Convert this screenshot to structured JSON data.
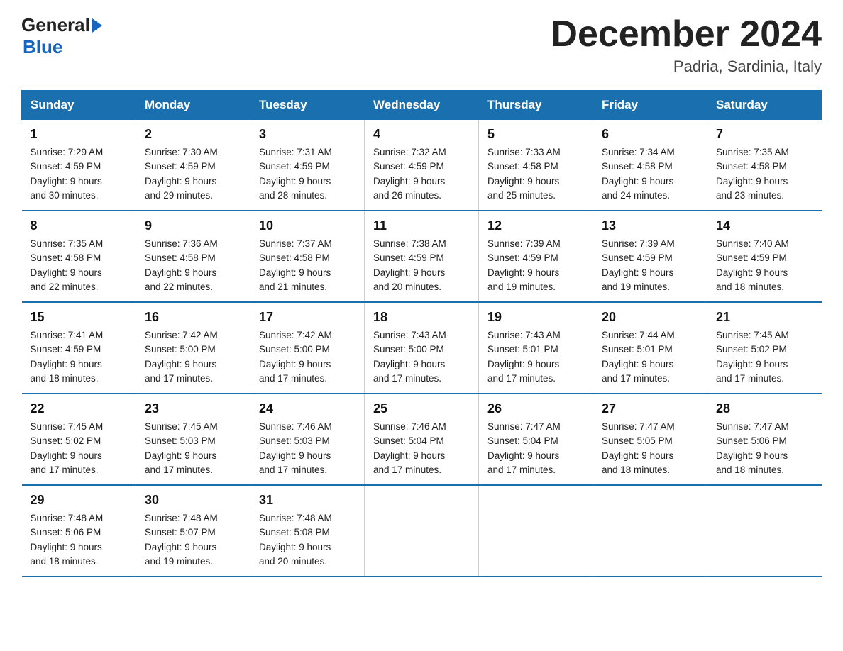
{
  "logo": {
    "general": "General",
    "blue": "Blue"
  },
  "title": "December 2024",
  "location": "Padria, Sardinia, Italy",
  "weekdays": [
    "Sunday",
    "Monday",
    "Tuesday",
    "Wednesday",
    "Thursday",
    "Friday",
    "Saturday"
  ],
  "weeks": [
    [
      {
        "day": "1",
        "sunrise": "7:29 AM",
        "sunset": "4:59 PM",
        "daylight": "9 hours and 30 minutes."
      },
      {
        "day": "2",
        "sunrise": "7:30 AM",
        "sunset": "4:59 PM",
        "daylight": "9 hours and 29 minutes."
      },
      {
        "day": "3",
        "sunrise": "7:31 AM",
        "sunset": "4:59 PM",
        "daylight": "9 hours and 28 minutes."
      },
      {
        "day": "4",
        "sunrise": "7:32 AM",
        "sunset": "4:59 PM",
        "daylight": "9 hours and 26 minutes."
      },
      {
        "day": "5",
        "sunrise": "7:33 AM",
        "sunset": "4:58 PM",
        "daylight": "9 hours and 25 minutes."
      },
      {
        "day": "6",
        "sunrise": "7:34 AM",
        "sunset": "4:58 PM",
        "daylight": "9 hours and 24 minutes."
      },
      {
        "day": "7",
        "sunrise": "7:35 AM",
        "sunset": "4:58 PM",
        "daylight": "9 hours and 23 minutes."
      }
    ],
    [
      {
        "day": "8",
        "sunrise": "7:35 AM",
        "sunset": "4:58 PM",
        "daylight": "9 hours and 22 minutes."
      },
      {
        "day": "9",
        "sunrise": "7:36 AM",
        "sunset": "4:58 PM",
        "daylight": "9 hours and 22 minutes."
      },
      {
        "day": "10",
        "sunrise": "7:37 AM",
        "sunset": "4:58 PM",
        "daylight": "9 hours and 21 minutes."
      },
      {
        "day": "11",
        "sunrise": "7:38 AM",
        "sunset": "4:59 PM",
        "daylight": "9 hours and 20 minutes."
      },
      {
        "day": "12",
        "sunrise": "7:39 AM",
        "sunset": "4:59 PM",
        "daylight": "9 hours and 19 minutes."
      },
      {
        "day": "13",
        "sunrise": "7:39 AM",
        "sunset": "4:59 PM",
        "daylight": "9 hours and 19 minutes."
      },
      {
        "day": "14",
        "sunrise": "7:40 AM",
        "sunset": "4:59 PM",
        "daylight": "9 hours and 18 minutes."
      }
    ],
    [
      {
        "day": "15",
        "sunrise": "7:41 AM",
        "sunset": "4:59 PM",
        "daylight": "9 hours and 18 minutes."
      },
      {
        "day": "16",
        "sunrise": "7:42 AM",
        "sunset": "5:00 PM",
        "daylight": "9 hours and 17 minutes."
      },
      {
        "day": "17",
        "sunrise": "7:42 AM",
        "sunset": "5:00 PM",
        "daylight": "9 hours and 17 minutes."
      },
      {
        "day": "18",
        "sunrise": "7:43 AM",
        "sunset": "5:00 PM",
        "daylight": "9 hours and 17 minutes."
      },
      {
        "day": "19",
        "sunrise": "7:43 AM",
        "sunset": "5:01 PM",
        "daylight": "9 hours and 17 minutes."
      },
      {
        "day": "20",
        "sunrise": "7:44 AM",
        "sunset": "5:01 PM",
        "daylight": "9 hours and 17 minutes."
      },
      {
        "day": "21",
        "sunrise": "7:45 AM",
        "sunset": "5:02 PM",
        "daylight": "9 hours and 17 minutes."
      }
    ],
    [
      {
        "day": "22",
        "sunrise": "7:45 AM",
        "sunset": "5:02 PM",
        "daylight": "9 hours and 17 minutes."
      },
      {
        "day": "23",
        "sunrise": "7:45 AM",
        "sunset": "5:03 PM",
        "daylight": "9 hours and 17 minutes."
      },
      {
        "day": "24",
        "sunrise": "7:46 AM",
        "sunset": "5:03 PM",
        "daylight": "9 hours and 17 minutes."
      },
      {
        "day": "25",
        "sunrise": "7:46 AM",
        "sunset": "5:04 PM",
        "daylight": "9 hours and 17 minutes."
      },
      {
        "day": "26",
        "sunrise": "7:47 AM",
        "sunset": "5:04 PM",
        "daylight": "9 hours and 17 minutes."
      },
      {
        "day": "27",
        "sunrise": "7:47 AM",
        "sunset": "5:05 PM",
        "daylight": "9 hours and 18 minutes."
      },
      {
        "day": "28",
        "sunrise": "7:47 AM",
        "sunset": "5:06 PM",
        "daylight": "9 hours and 18 minutes."
      }
    ],
    [
      {
        "day": "29",
        "sunrise": "7:48 AM",
        "sunset": "5:06 PM",
        "daylight": "9 hours and 18 minutes."
      },
      {
        "day": "30",
        "sunrise": "7:48 AM",
        "sunset": "5:07 PM",
        "daylight": "9 hours and 19 minutes."
      },
      {
        "day": "31",
        "sunrise": "7:48 AM",
        "sunset": "5:08 PM",
        "daylight": "9 hours and 20 minutes."
      },
      null,
      null,
      null,
      null
    ]
  ],
  "labels": {
    "sunrise": "Sunrise:",
    "sunset": "Sunset:",
    "daylight": "Daylight:"
  }
}
